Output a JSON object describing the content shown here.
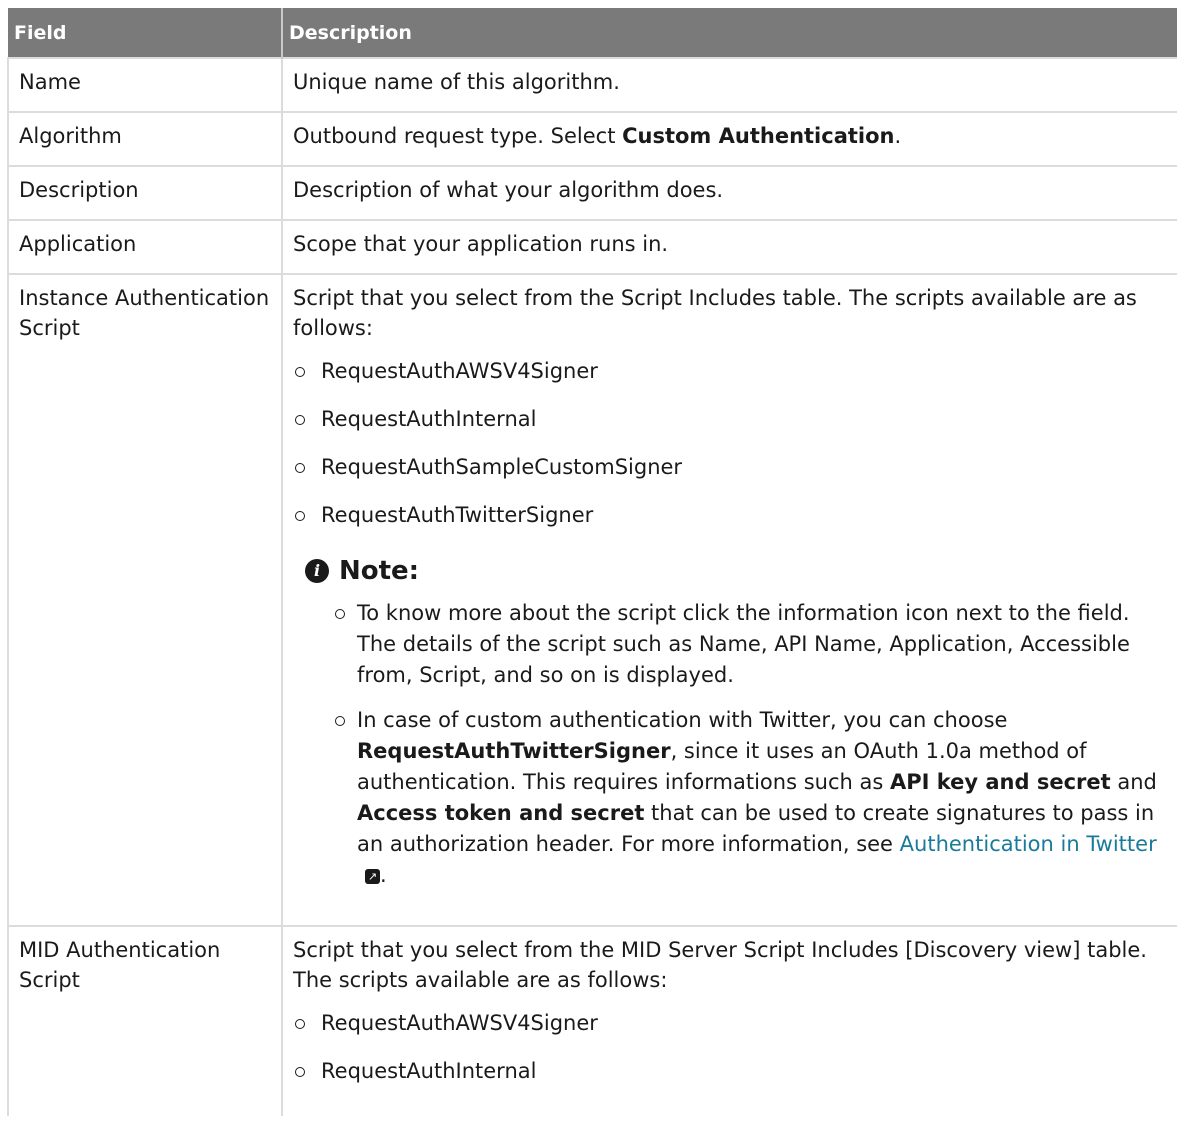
{
  "table": {
    "headers": [
      "Field",
      "Description"
    ],
    "rows": [
      {
        "field": "Name",
        "desc": "Unique name of this algorithm."
      },
      {
        "field": "Algorithm",
        "desc_pre": "Outbound request type. Select ",
        "desc_bold": "Custom Authentication",
        "desc_post": "."
      },
      {
        "field": "Description",
        "desc": "Description of what your algorithm does."
      },
      {
        "field": "Application",
        "desc": "Scope that your application runs in."
      },
      {
        "field": "Instance Authentication Script",
        "desc": "Script that you select from the Script Includes table. The scripts available are as follows:",
        "options": [
          "RequestAuthAWSV4Signer",
          "RequestAuthInternal",
          "RequestAuthSampleCustomSigner",
          "RequestAuthTwitterSigner"
        ],
        "note": {
          "title": "Note:",
          "item1": "To know more about the script click the information icon next to the field. The details of the script such as Name, API Name, Application, Accessible from, Script, and so on is displayed.",
          "item2_a": "In case of custom authentication with Twitter, you can choose ",
          "item2_b": "RequestAuthTwitterSigner",
          "item2_c": ", since it uses an OAuth 1.0a method of authentication. This requires informations such as ",
          "item2_d": "API key and secret",
          "item2_e": " and ",
          "item2_f": "Access token and secret",
          "item2_g": " that can be used to create signatures to pass in an authorization header. For more information, see ",
          "item2_link": "Authentication in Twitter",
          "item2_h": "."
        }
      },
      {
        "field": "MID Authentication Script",
        "desc": "Script that you select from the MID Server Script Includes [Discovery view] table. The scripts available are as follows:",
        "options": [
          "RequestAuthAWSV4Signer",
          "RequestAuthInternal"
        ]
      }
    ]
  }
}
